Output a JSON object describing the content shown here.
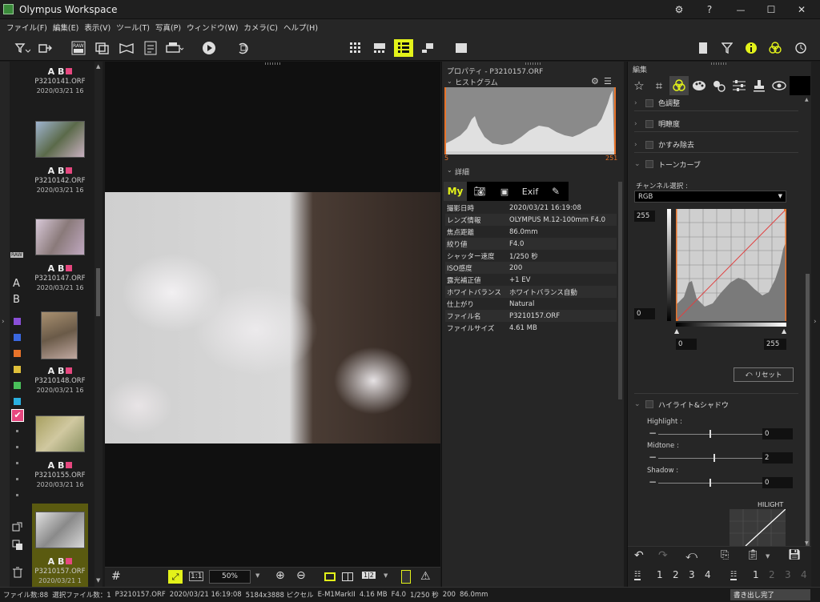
{
  "app": {
    "title": "Olympus Workspace"
  },
  "window_controls": {
    "gear": "⚙",
    "help": "?",
    "minimize": "—",
    "maximize": "☐",
    "close": "✕"
  },
  "menu": [
    "ファイル(F)",
    "編集(E)",
    "表示(V)",
    "ツール(T)",
    "写真(P)",
    "ウィンドウ(W)",
    "カメラ(C)",
    "ヘルプ(H)"
  ],
  "thumbnails": [
    {
      "ab": "A B",
      "name": "P3210141.ORF",
      "date": "2020/03/21 16"
    },
    {
      "ab": "A B",
      "name": "P3210142.ORF",
      "date": "2020/03/21 16"
    },
    {
      "ab": "A B",
      "name": "P3210147.ORF",
      "date": "2020/03/21 16"
    },
    {
      "ab": "A B",
      "name": "P3210148.ORF",
      "date": "2020/03/21 16"
    },
    {
      "ab": "A B",
      "name": "P3210155.ORF",
      "date": "2020/03/21 16"
    },
    {
      "ab": "A B",
      "name": "P3210157.ORF",
      "date": "2020/03/21 1"
    }
  ],
  "label_strip": {
    "raw": "RAW",
    "a": "A",
    "b": "B",
    "colors": [
      "#8a4fd8",
      "#3a68e0",
      "#e8732a",
      "#e0c03a",
      "#49c05a",
      "#2ab0e0"
    ]
  },
  "viewer": {
    "zoom": "50%",
    "toolbar_11": "1:1",
    "toolbar_12": "1|2"
  },
  "properties": {
    "header": "プロパティ - P3210157.ORF",
    "histogram_label": "ヒストグラム",
    "hist_min": "5",
    "hist_max": "251",
    "details_label": "詳細",
    "tab_my": "My",
    "tab_exif": "Exif",
    "rows": [
      {
        "k": "撮影日時",
        "v": "2020/03/21 16:19:08"
      },
      {
        "k": "レンズ情報",
        "v": "OLYMPUS M.12-100mm F4.0"
      },
      {
        "k": "焦点距離",
        "v": "86.0mm"
      },
      {
        "k": "絞り値",
        "v": "F4.0"
      },
      {
        "k": "シャッター速度",
        "v": "1/250 秒"
      },
      {
        "k": "ISO感度",
        "v": "200"
      },
      {
        "k": "露光補正値",
        "v": "+1 EV"
      },
      {
        "k": "ホワイトバランス",
        "v": "ホワイトバランス自動"
      },
      {
        "k": "仕上がり",
        "v": "Natural"
      },
      {
        "k": "ファイル名",
        "v": "P3210157.ORF"
      },
      {
        "k": "ファイルサイズ",
        "v": "4.61 MB"
      }
    ]
  },
  "edit": {
    "header": "編集",
    "sections": [
      "色調整",
      "明瞭度",
      "かすみ除去",
      "トーンカーブ"
    ],
    "channel_label": "チャンネル選択 :",
    "channel_value": "RGB",
    "curve_top": "255",
    "curve_bottom": "0",
    "input_low": "0",
    "input_high": "255",
    "reset_label": "リセット",
    "hs_section": "ハイライト&シャドウ",
    "sliders": [
      {
        "label": "Highlight :",
        "value": "0",
        "pos": 0.5
      },
      {
        "label": "Midtone :",
        "value": "2",
        "pos": 0.54
      },
      {
        "label": "Shadow :",
        "value": "0",
        "pos": 0.5
      }
    ],
    "hilight_label": "HILIGHT",
    "preset_nums": [
      "1",
      "2",
      "3",
      "4"
    ],
    "set_nums": [
      "1",
      "2",
      "3",
      "4"
    ]
  },
  "status": {
    "items": [
      "ファイル数:88",
      "選択ファイル数：1",
      "P3210157.ORF",
      "2020/03/21 16:19:08",
      "5184x3888 ピクセル",
      "E-M1MarkII",
      "4.16 MB",
      "F4.0",
      "1/250 秒",
      "200",
      "86.0mm"
    ],
    "export": "書き出し完了"
  }
}
